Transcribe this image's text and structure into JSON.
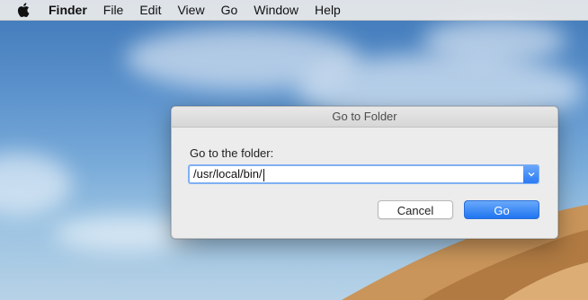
{
  "menubar": {
    "app_name": "Finder",
    "items": [
      "File",
      "Edit",
      "View",
      "Go",
      "Window",
      "Help"
    ]
  },
  "dialog": {
    "title": "Go to Folder",
    "prompt": "Go to the folder:",
    "path_value": "/usr/local/bin/",
    "cancel_label": "Cancel",
    "go_label": "Go"
  },
  "colors": {
    "accent": "#2a7af3",
    "focus_ring": "#7fb0f2"
  },
  "icons": {
    "apple": "apple-logo-icon",
    "dropdown": "chevron-down-icon"
  }
}
